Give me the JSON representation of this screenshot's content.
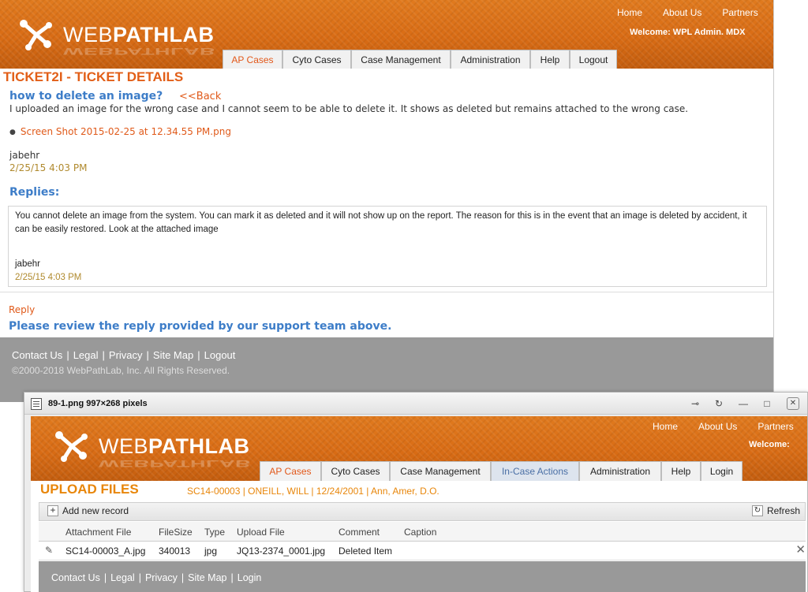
{
  "window1": {
    "brand": {
      "light": "WEB",
      "bold": "PATHLAB",
      "reflection": "WEBPATHLAB"
    },
    "toplinks": [
      "Home",
      "About Us",
      "Partners"
    ],
    "welcome": "Welcome: WPL Admin. MDX",
    "tabs": [
      "AP Cases",
      "Cyto Cases",
      "Case Management",
      "Administration",
      "Help",
      "Logout"
    ],
    "page_title": "TICKET2I - TICKET DETAILS",
    "ticket": {
      "subject": "how to delete an image?",
      "back": "<<Back",
      "description": "I uploaded an image for the wrong case and I cannot seem to be able to delete it.  It shows as deleted but remains attached to the wrong case.",
      "attachment": "Screen Shot 2015-02-25 at 12.34.55 PM.png",
      "author": "jabehr",
      "time": "2/25/15 4:03 PM"
    },
    "replies_heading": "Replies:",
    "reply": {
      "text": "You cannot delete an image from the system.  You can mark it as deleted and it will not show up on the report. The reason for this is in the event that an image is deleted by accident, it can be easily restored.  Look at the attached image",
      "author": "jabehr",
      "time": "2/25/15 4:03 PM"
    },
    "reply_link": "Reply",
    "notice": "Please review the reply provided by our support team above.",
    "footer_links": [
      "Contact Us",
      "Legal",
      "Privacy",
      "Site Map",
      "Logout"
    ],
    "copyright": "©2000-2018 WebPathLab, Inc. All Rights Reserved."
  },
  "window2": {
    "title": "89-1.png 997×268 pixels",
    "controls": [
      "pin-icon",
      "refresh-icon",
      "minimize-icon",
      "maximize-icon",
      "close-icon"
    ],
    "brand": {
      "light": "WEB",
      "bold": "PATHLAB",
      "reflection": "WEBPATHLAB"
    },
    "toplinks": [
      "Home",
      "About Us",
      "Partners"
    ],
    "welcome": "Welcome:",
    "tabs": [
      "AP Cases",
      "Cyto Cases",
      "Case Management",
      "In-Case Actions",
      "Administration",
      "Help",
      "Login"
    ],
    "heading": "UPLOAD FILES",
    "case_info": "SC14-00003 | ONEILL, WILL | 12/24/2001 | Ann, Amer, D.O.",
    "add_label": "Add new record",
    "refresh_label": "Refresh",
    "columns": [
      "Attachment File",
      "FileSize",
      "Type",
      "Upload File",
      "Comment",
      "Caption"
    ],
    "rows": [
      [
        "SC14-00003_A.jpg",
        "340013",
        "jpg",
        "JQ13-2374_0001.jpg",
        "Deleted Item",
        ""
      ]
    ],
    "footer_links": [
      "Contact Us",
      "Legal",
      "Privacy",
      "Site Map",
      "Login"
    ]
  },
  "colors": {
    "brand_orange": "#d96c15",
    "link_blue": "#3d7dc8",
    "link_orange": "#e05a1a",
    "timestamp": "#b08a2e",
    "footer_gray": "#999999"
  }
}
